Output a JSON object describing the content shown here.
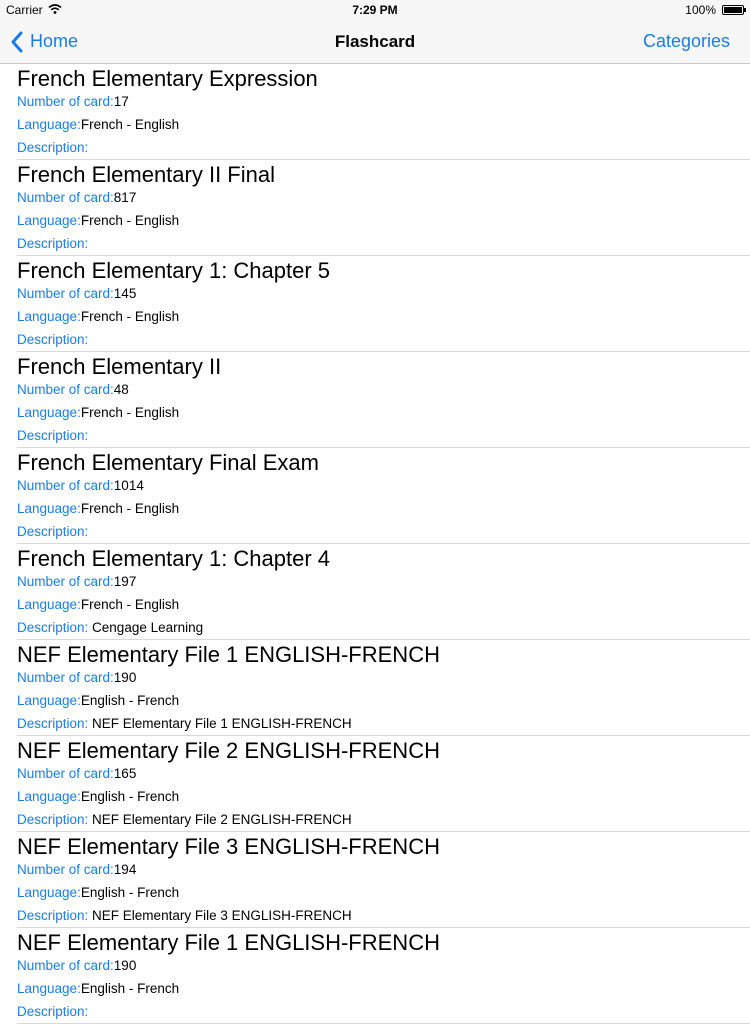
{
  "status": {
    "carrier": "Carrier",
    "time": "7:29 PM",
    "battery": "100%"
  },
  "nav": {
    "back": "Home",
    "title": "Flashcard",
    "right": "Categories"
  },
  "labels": {
    "num": "Number of card:",
    "lang": "Language:",
    "desc": "Description:"
  },
  "cards": [
    {
      "title": "French Elementary Expression",
      "count": "17",
      "language": "French - English",
      "description": ""
    },
    {
      "title": "French Elementary II Final",
      "count": "817",
      "language": "French - English",
      "description": ""
    },
    {
      "title": "French Elementary 1: Chapter 5",
      "count": "145",
      "language": "French - English",
      "description": ""
    },
    {
      "title": "French Elementary II",
      "count": "48",
      "language": "French - English",
      "description": ""
    },
    {
      "title": "French Elementary Final Exam",
      "count": "1014",
      "language": "French - English",
      "description": ""
    },
    {
      "title": "French Elementary 1: Chapter 4",
      "count": "197",
      "language": "French - English",
      "description": "Cengage Learning"
    },
    {
      "title": "NEF Elementary File 1 ENGLISH-FRENCH",
      "count": "190",
      "language": "English - French",
      "description": "NEF Elementary File 1 ENGLISH-FRENCH"
    },
    {
      "title": "NEF Elementary File 2 ENGLISH-FRENCH",
      "count": "165",
      "language": "English - French",
      "description": "NEF Elementary File 2 ENGLISH-FRENCH"
    },
    {
      "title": "NEF Elementary File 3 ENGLISH-FRENCH",
      "count": "194",
      "language": "English - French",
      "description": "NEF Elementary File 3 ENGLISH-FRENCH"
    },
    {
      "title": "NEF Elementary File 1 ENGLISH-FRENCH",
      "count": "190",
      "language": "English - French",
      "description": ""
    }
  ]
}
